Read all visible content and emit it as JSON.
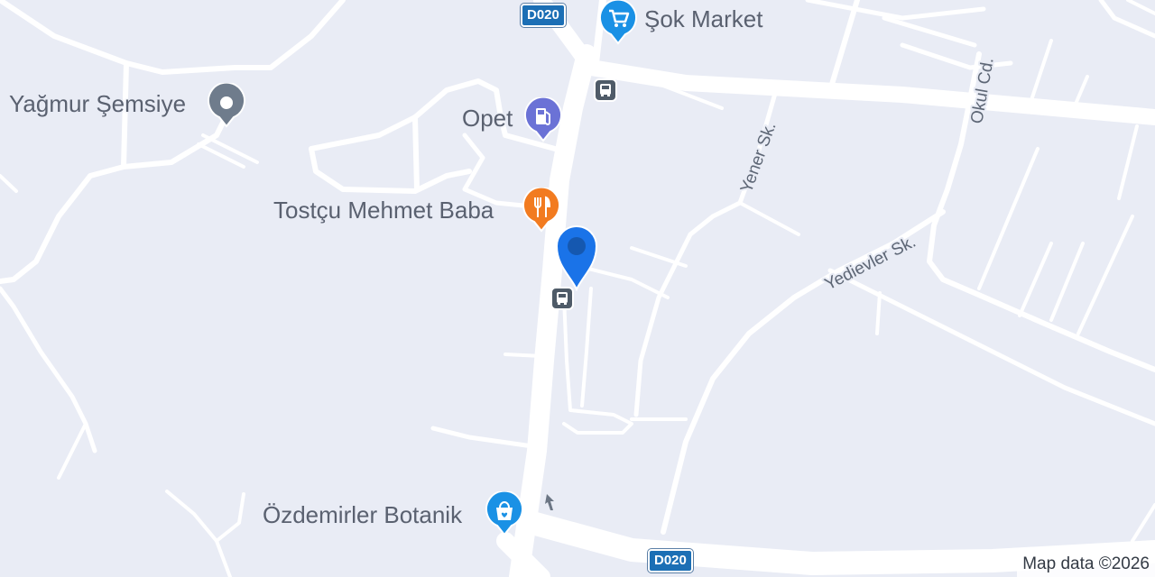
{
  "colors": {
    "background": "#e9ecf5",
    "road": "#ffffff",
    "location_marker": "#1a73e8",
    "shopping_pin": "#1a91e5",
    "fuel_pin": "#6b72d6",
    "restaurant_pin": "#f27b20",
    "place_pin": "#6f7c8c",
    "transit": "#4f5b68",
    "highway_shield": "#1c6fb5"
  },
  "pois": [
    {
      "name": "Şok Market",
      "category": "shopping",
      "icon": "shopping-cart-icon"
    },
    {
      "name": "Yağmur Şemsiye",
      "category": "place",
      "icon": "place-dot-icon"
    },
    {
      "name": "Opet",
      "category": "fuel",
      "icon": "fuel-pump-icon"
    },
    {
      "name": "Tostçu Mehmet Baba",
      "category": "restaurant",
      "icon": "fork-knife-icon"
    },
    {
      "name": "Özdemirler Botanik",
      "category": "shopping",
      "icon": "shopping-bag-icon"
    }
  ],
  "streets": {
    "yener": "Yener Sk.",
    "yedievler": "Yedievler Sk.",
    "okul": "Okul Cd."
  },
  "highway": {
    "north": "D020",
    "south": "D020"
  },
  "transit": {
    "icon": "bus-stop-icon"
  },
  "current_location": {
    "icon": "location-pin-icon"
  },
  "attribution": "Map data ©2026"
}
